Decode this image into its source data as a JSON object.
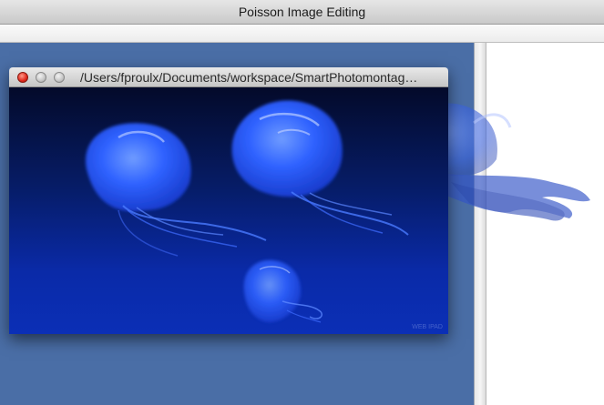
{
  "app": {
    "title": "Poisson Image Editing"
  },
  "document_window": {
    "path_title": "/Users/fproulx/Documents/workspace/SmartPhotomontag…",
    "watermark": "WEB IPAD"
  },
  "image": {
    "subject_icons": [
      "jellyfish-icon",
      "jellyfish-icon",
      "jellyfish-icon",
      "jellyfish-icon"
    ]
  },
  "colors": {
    "canvas_background": "#4a6ea6",
    "jellyfish_glow": "#3a6cff",
    "close_button": "#e0271b"
  }
}
